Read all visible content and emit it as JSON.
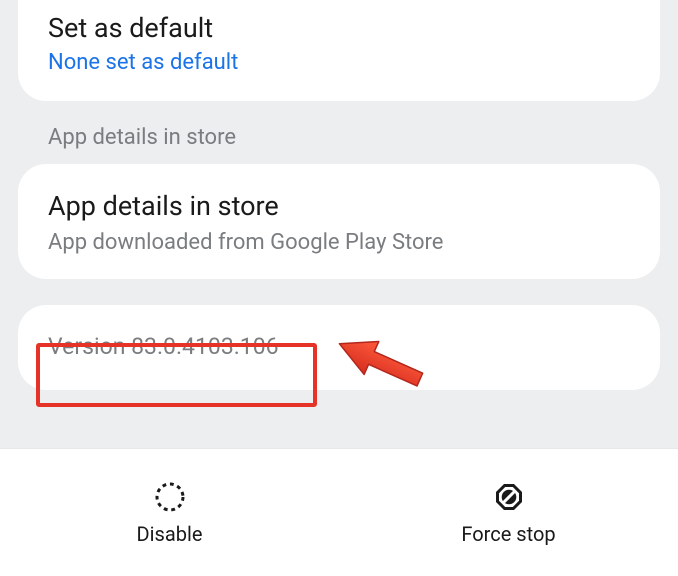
{
  "default": {
    "title": "Set as default",
    "status": "None set as default"
  },
  "section_label": "App details in store",
  "store": {
    "title": "App details in store",
    "subtitle": "App downloaded from Google Play Store"
  },
  "version": {
    "text": "Version 83.0.4103.106"
  },
  "actions": {
    "disable": "Disable",
    "force_stop": "Force stop"
  }
}
